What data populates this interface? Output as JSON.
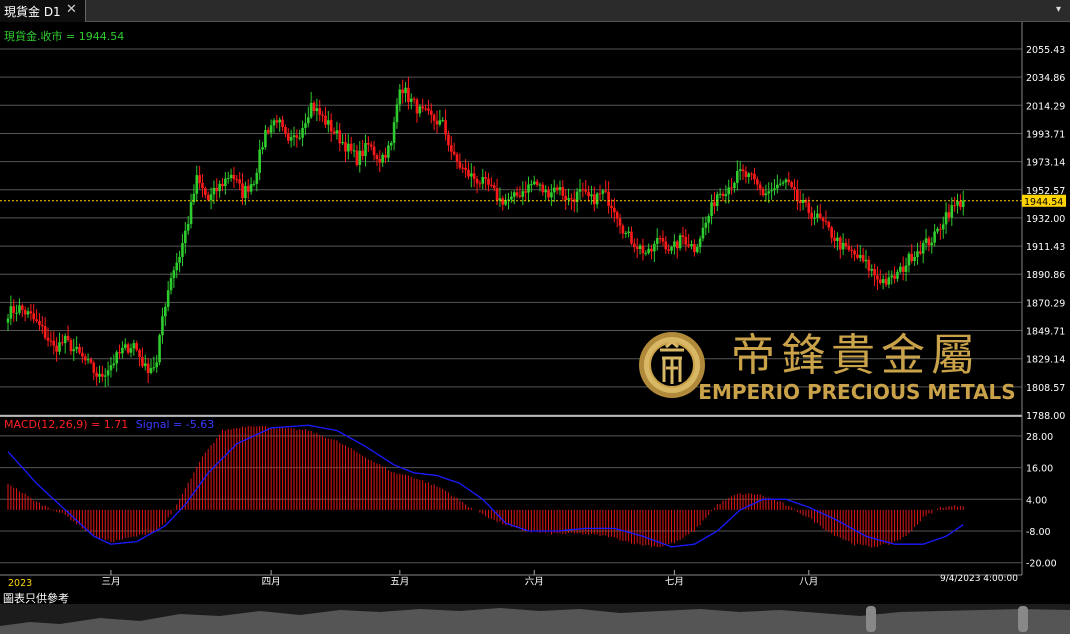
{
  "tab": {
    "title": "現貨金 D1",
    "close": "✕",
    "menu": "▾"
  },
  "price_legend": "現貨金.收市 = 1944.54",
  "macd_legend": {
    "macd": "MACD(12,26,9) = 1.71",
    "signal": "Signal = -5.63"
  },
  "watermark": {
    "chinese": "帝鋒貴金屬",
    "english": "EMPERIO PRECIOUS METALS"
  },
  "footer_note": "圖表只供參考",
  "colors": {
    "up": "#2ecc2e",
    "down": "#ff1a1a",
    "macd_hist": "#e01818",
    "signal": "#1a1aff",
    "gold": "#c9a24a",
    "current": "#ffd400"
  },
  "chart_data": {
    "type": "candlestick",
    "title": "",
    "current_price": 1944.54,
    "price_axis": {
      "min": 1788.0,
      "max": 2062.0,
      "ticks": [
        "2055.43",
        "2034.86",
        "2014.29",
        "1993.71",
        "1973.14",
        "1952.57",
        "1932.00",
        "1911.43",
        "1890.86",
        "1870.29",
        "1849.71",
        "1829.14",
        "1808.57",
        "1788.00"
      ],
      "tick_values": [
        2055.43,
        2034.86,
        2014.29,
        1993.71,
        1973.14,
        1952.57,
        1932.0,
        1911.43,
        1890.86,
        1870.29,
        1849.71,
        1829.14,
        1808.57,
        1788.0
      ]
    },
    "macd_axis": {
      "min": -22,
      "max": 34,
      "ticks": [
        "28.00",
        "16.00",
        "4.00",
        "-8.00",
        "-20.00"
      ],
      "tick_values": [
        28,
        16,
        4,
        -8,
        -20
      ]
    },
    "x_axis": {
      "start_label": "2023",
      "months": [
        {
          "label": "三月",
          "index": 36
        },
        {
          "label": "四月",
          "index": 92
        },
        {
          "label": "五月",
          "index": 137
        },
        {
          "label": "六月",
          "index": 184
        },
        {
          "label": "七月",
          "index": 233
        },
        {
          "label": "八月",
          "index": 280
        }
      ],
      "end_label": "9/4/2023 4:00:00"
    },
    "anchors": [
      [
        0,
        1863
      ],
      [
        4,
        1866
      ],
      [
        8,
        1860
      ],
      [
        12,
        1850
      ],
      [
        16,
        1837
      ],
      [
        20,
        1842
      ],
      [
        24,
        1834
      ],
      [
        28,
        1825
      ],
      [
        32,
        1815
      ],
      [
        36,
        1825
      ],
      [
        40,
        1835
      ],
      [
        44,
        1840
      ],
      [
        48,
        1822
      ],
      [
        52,
        1825
      ],
      [
        54,
        1860
      ],
      [
        57,
        1890
      ],
      [
        60,
        1905
      ],
      [
        63,
        1930
      ],
      [
        66,
        1960
      ],
      [
        70,
        1945
      ],
      [
        74,
        1955
      ],
      [
        78,
        1965
      ],
      [
        82,
        1950
      ],
      [
        86,
        1960
      ],
      [
        90,
        1995
      ],
      [
        94,
        2005
      ],
      [
        98,
        1985
      ],
      [
        102,
        1995
      ],
      [
        106,
        2015
      ],
      [
        110,
        2005
      ],
      [
        114,
        1995
      ],
      [
        118,
        1985
      ],
      [
        122,
        1975
      ],
      [
        126,
        1985
      ],
      [
        130,
        1975
      ],
      [
        134,
        1985
      ],
      [
        137,
        2030
      ],
      [
        140,
        2020
      ],
      [
        144,
        2010
      ],
      [
        148,
        2005
      ],
      [
        152,
        2000
      ],
      [
        156,
        1975
      ],
      [
        160,
        1965
      ],
      [
        164,
        1960
      ],
      [
        168,
        1955
      ],
      [
        172,
        1945
      ],
      [
        176,
        1945
      ],
      [
        180,
        1952
      ],
      [
        184,
        1958
      ],
      [
        188,
        1950
      ],
      [
        192,
        1955
      ],
      [
        196,
        1945
      ],
      [
        200,
        1950
      ],
      [
        204,
        1945
      ],
      [
        208,
        1950
      ],
      [
        212,
        1940
      ],
      [
        216,
        1920
      ],
      [
        220,
        1912
      ],
      [
        224,
        1905
      ],
      [
        228,
        1918
      ],
      [
        232,
        1908
      ],
      [
        236,
        1918
      ],
      [
        240,
        1910
      ],
      [
        244,
        1928
      ],
      [
        248,
        1950
      ],
      [
        252,
        1955
      ],
      [
        256,
        1965
      ],
      [
        260,
        1960
      ],
      [
        264,
        1950
      ],
      [
        268,
        1953
      ],
      [
        272,
        1958
      ],
      [
        276,
        1945
      ],
      [
        280,
        1937
      ],
      [
        284,
        1930
      ],
      [
        288,
        1920
      ],
      [
        292,
        1910
      ],
      [
        296,
        1905
      ],
      [
        300,
        1898
      ],
      [
        304,
        1888
      ],
      [
        308,
        1885
      ],
      [
        312,
        1893
      ],
      [
        316,
        1905
      ],
      [
        320,
        1912
      ],
      [
        324,
        1918
      ],
      [
        328,
        1935
      ],
      [
        332,
        1942
      ],
      [
        334,
        1944.54
      ]
    ],
    "macd_anchors": [
      [
        0,
        10
      ],
      [
        10,
        3
      ],
      [
        20,
        -2
      ],
      [
        30,
        -10
      ],
      [
        36,
        -12
      ],
      [
        45,
        -10
      ],
      [
        52,
        -8
      ],
      [
        57,
        -2
      ],
      [
        62,
        8
      ],
      [
        68,
        20
      ],
      [
        75,
        30
      ],
      [
        85,
        32
      ],
      [
        95,
        31
      ],
      [
        105,
        30
      ],
      [
        115,
        26
      ],
      [
        125,
        20
      ],
      [
        135,
        14
      ],
      [
        140,
        13
      ],
      [
        145,
        11
      ],
      [
        152,
        8
      ],
      [
        160,
        2
      ],
      [
        170,
        -4
      ],
      [
        180,
        -8
      ],
      [
        190,
        -9
      ],
      [
        200,
        -9
      ],
      [
        210,
        -10
      ],
      [
        220,
        -13
      ],
      [
        228,
        -14
      ],
      [
        234,
        -12
      ],
      [
        240,
        -8
      ],
      [
        248,
        2
      ],
      [
        255,
        6
      ],
      [
        262,
        6
      ],
      [
        270,
        3
      ],
      [
        280,
        -3
      ],
      [
        288,
        -9
      ],
      [
        296,
        -13
      ],
      [
        302,
        -14
      ],
      [
        308,
        -13
      ],
      [
        314,
        -10
      ],
      [
        320,
        -3
      ],
      [
        326,
        1
      ],
      [
        334,
        1.71
      ]
    ],
    "signal_anchors": [
      [
        0,
        22
      ],
      [
        10,
        10
      ],
      [
        20,
        0
      ],
      [
        30,
        -10
      ],
      [
        36,
        -13
      ],
      [
        45,
        -12
      ],
      [
        55,
        -6
      ],
      [
        62,
        2
      ],
      [
        70,
        14
      ],
      [
        80,
        25
      ],
      [
        92,
        31
      ],
      [
        105,
        32
      ],
      [
        115,
        30
      ],
      [
        125,
        24
      ],
      [
        135,
        17
      ],
      [
        142,
        14
      ],
      [
        150,
        13
      ],
      [
        158,
        10
      ],
      [
        166,
        4
      ],
      [
        174,
        -5
      ],
      [
        182,
        -8
      ],
      [
        192,
        -8
      ],
      [
        202,
        -7
      ],
      [
        212,
        -7
      ],
      [
        222,
        -10
      ],
      [
        232,
        -14
      ],
      [
        240,
        -13
      ],
      [
        248,
        -8
      ],
      [
        256,
        0
      ],
      [
        264,
        4
      ],
      [
        272,
        4
      ],
      [
        280,
        1
      ],
      [
        290,
        -4
      ],
      [
        300,
        -10
      ],
      [
        310,
        -13
      ],
      [
        320,
        -13
      ],
      [
        328,
        -10
      ],
      [
        334,
        -5.63
      ]
    ],
    "bar_count": 335
  }
}
